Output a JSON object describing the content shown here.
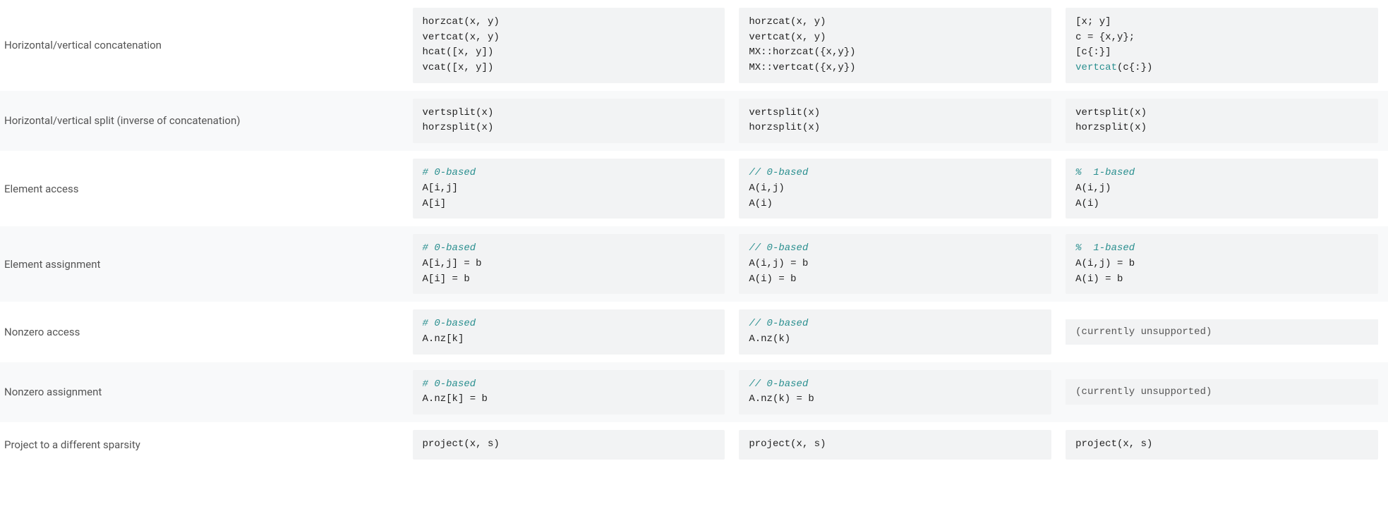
{
  "rows": [
    {
      "label": "Horizontal/vertical concatenation",
      "col1": [
        {
          "txt": "horzcat(x, y)"
        },
        {
          "txt": "vertcat(x, y)"
        },
        {
          "txt": "hcat([x, y])"
        },
        {
          "txt": "vcat([x, y])"
        }
      ],
      "col2": [
        {
          "txt": "horzcat(x, y)"
        },
        {
          "txt": "vertcat(x, y)"
        },
        {
          "txt": "MX::horzcat({x,y})"
        },
        {
          "txt": "MX::vertcat({x,y})"
        }
      ],
      "col3": [
        {
          "txt": "[x; y]"
        },
        {
          "txt": "c = {x,y};"
        },
        {
          "txt": "[c{:}]"
        },
        {
          "txt": "vertcat",
          "cls": "fn",
          "tail": "(c{:})"
        }
      ]
    },
    {
      "label": "Horizontal/vertical split (inverse of concatenation)",
      "col1": [
        {
          "txt": "vertsplit(x)"
        },
        {
          "txt": "horzsplit(x)"
        }
      ],
      "col2": [
        {
          "txt": "vertsplit(x)"
        },
        {
          "txt": "horzsplit(x)"
        }
      ],
      "col3": [
        {
          "txt": "vertsplit(x)"
        },
        {
          "txt": "horzsplit(x)"
        }
      ]
    },
    {
      "label": "Element access",
      "col1": [
        {
          "txt": "# 0-based",
          "cls": "comment"
        },
        {
          "txt": "A[i,j]"
        },
        {
          "txt": "A[i]"
        }
      ],
      "col2": [
        {
          "txt": "// 0-based",
          "cls": "comment"
        },
        {
          "txt": "A(i,j)"
        },
        {
          "txt": "A(i)"
        }
      ],
      "col3": [
        {
          "txt": "%  1-based",
          "cls": "comment"
        },
        {
          "txt": "A(i,j)"
        },
        {
          "txt": "A(i)"
        }
      ]
    },
    {
      "label": "Element assignment",
      "col1": [
        {
          "txt": "# 0-based",
          "cls": "comment"
        },
        {
          "txt": "A[i,j] = b"
        },
        {
          "txt": "A[i] = b"
        }
      ],
      "col2": [
        {
          "txt": "// 0-based",
          "cls": "comment"
        },
        {
          "txt": "A(i,j) = b"
        },
        {
          "txt": "A(i) = b"
        }
      ],
      "col3": [
        {
          "txt": "%  1-based",
          "cls": "comment"
        },
        {
          "txt": "A(i,j) = b"
        },
        {
          "txt": "A(i) = b"
        }
      ]
    },
    {
      "label": "Nonzero access",
      "col1": [
        {
          "txt": "# 0-based",
          "cls": "comment"
        },
        {
          "txt": "A.nz[k]"
        }
      ],
      "col2": [
        {
          "txt": "// 0-based",
          "cls": "comment"
        },
        {
          "txt": "A.nz(k)"
        }
      ],
      "col3_unsupported": "(currently unsupported)"
    },
    {
      "label": "Nonzero assignment",
      "col1": [
        {
          "txt": "# 0-based",
          "cls": "comment"
        },
        {
          "txt": "A.nz[k] = b"
        }
      ],
      "col2": [
        {
          "txt": "// 0-based",
          "cls": "comment"
        },
        {
          "txt": "A.nz(k) = b"
        }
      ],
      "col3_unsupported": "(currently unsupported)"
    },
    {
      "label": "Project to a different sparsity",
      "col1": [
        {
          "txt": "project(x, s)"
        }
      ],
      "col2": [
        {
          "txt": "project(x, s)"
        }
      ],
      "col3": [
        {
          "txt": "project(x, s)"
        }
      ]
    }
  ]
}
